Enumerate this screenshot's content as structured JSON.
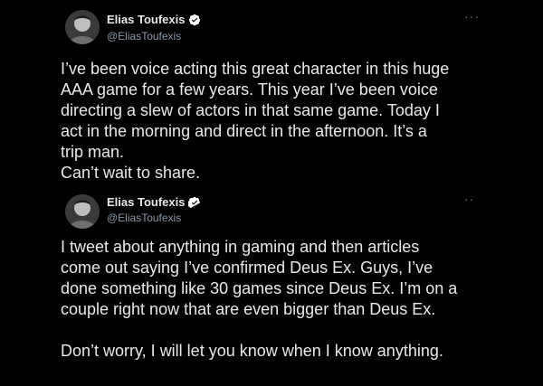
{
  "tweets": [
    {
      "author": {
        "display_name": "Elias Toufexis",
        "handle": "@EliasToufexis",
        "verified": true
      },
      "more_icon": "more-dots-icon",
      "text": "I’ve been voice acting this great character in this huge\nAAA game for a few years. This year I’ve been voice\ndirecting a slew of actors in that same game. Today I\nact in the morning and direct in the afternoon. It’s a\ntrip man.\nCan’t wait to share."
    },
    {
      "author": {
        "display_name": "Elias Toufexis",
        "handle": "@EliasToufexis",
        "verified": true
      },
      "more_icon": "more-dots-icon",
      "text": "I tweet about anything in gaming and then articles\ncome out saying I’ve confirmed Deus Ex. Guys, I’ve\ndone something like 30 games since Deus Ex. I’m on a\ncouple right now that are even bigger than Deus Ex.\n\nDon’t worry, I will let you know when I know anything."
    }
  ],
  "colors": {
    "background": "#000000",
    "text": "#e7e9ea",
    "secondary_text": "#8b98a5",
    "verified_badge": "#ffffff"
  }
}
